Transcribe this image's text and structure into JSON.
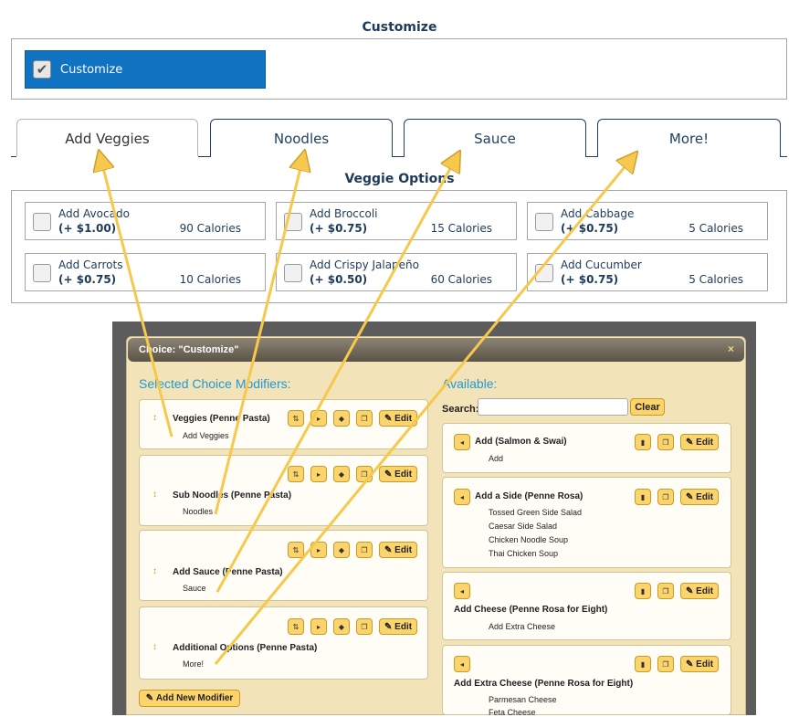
{
  "customize": {
    "title": "Customize",
    "button_label": "Customize",
    "check_glyph": "✔"
  },
  "tabs": [
    "Add Veggies",
    "Noodles",
    "Sauce",
    "More!"
  ],
  "veggie_options": {
    "title": "Veggie Options",
    "items": [
      {
        "name": "Add Avocado",
        "price": "(+ $1.00)",
        "calories": "90 Calories"
      },
      {
        "name": "Add Broccoli",
        "price": "(+ $0.75)",
        "calories": "15 Calories"
      },
      {
        "name": "Add Cabbage",
        "price": "(+ $0.75)",
        "calories": "5 Calories"
      },
      {
        "name": "Add Carrots",
        "price": "(+ $0.75)",
        "calories": "10 Calories"
      },
      {
        "name": "Add Crispy Jalapeño",
        "price": "(+ $0.50)",
        "calories": "60 Calories"
      },
      {
        "name": "Add Cucumber",
        "price": "(+ $0.75)",
        "calories": "5 Calories"
      }
    ]
  },
  "dialog": {
    "title": "Choice: \"Customize\"",
    "close_glyph": "×",
    "selected_title": "Selected Choice Modifiers:",
    "available_title": "Available:",
    "search_label": "Search:",
    "search_value": "",
    "clear_label": "Clear",
    "edit_label": "Edit",
    "drag_glyph": "↕",
    "add_modifier_label": "Add New Modifier",
    "selected": [
      {
        "title": "Veggies (Penne Pasta)",
        "subtitle": "Add Veggies"
      },
      {
        "title": "Sub Noodles (Penne Pasta)",
        "subtitle": "Noodles"
      },
      {
        "title": "Add Sauce (Penne Pasta)",
        "subtitle": "Sauce"
      },
      {
        "title": "Additional Options (Penne Pasta)",
        "subtitle": "More!"
      }
    ],
    "available": [
      {
        "title": "Add (Salmon & Swai)",
        "items": [
          "Add"
        ]
      },
      {
        "title": "Add a Side (Penne Rosa)",
        "items": [
          "Tossed Green Side Salad",
          "Caesar Side Salad",
          "Chicken Noodle Soup",
          "Thai Chicken Soup"
        ]
      },
      {
        "title": "Add Cheese (Penne Rosa for Eight)",
        "items": [
          "Add Extra Cheese"
        ]
      },
      {
        "title": "Add Extra Cheese (Penne Rosa for Eight)",
        "items": [
          "Parmesan Cheese",
          "Feta Cheese"
        ]
      }
    ]
  },
  "colors": {
    "accent_blue": "#0f73c2",
    "button_yellow": "#fbd46b",
    "dialog_bg": "#f2e3b8",
    "arrow": "#f6c84c"
  }
}
